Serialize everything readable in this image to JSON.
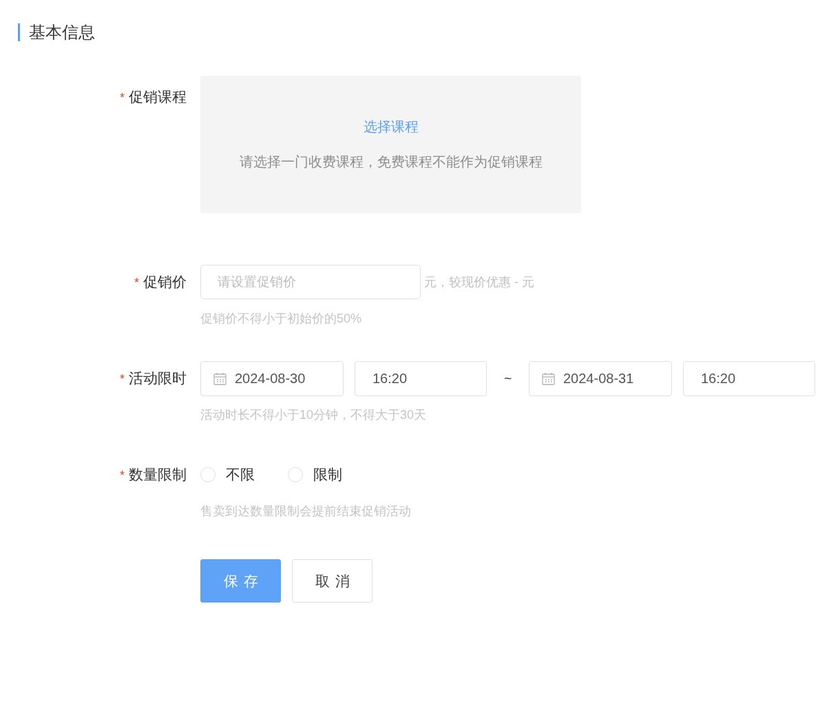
{
  "section": {
    "title": "基本信息"
  },
  "fields": [
    {
      "kind": "course",
      "label": "促销课程",
      "required_mark": "*",
      "link": "选择课程",
      "description": "请选择一门收费课程，免费课程不能作为促销课程"
    },
    {
      "kind": "price",
      "label": "促销价",
      "required_mark": "*",
      "placeholder": "请设置促销价",
      "suffix": "元，较现价优惠 - 元",
      "hint": "促销价不得小于初始价的50%"
    },
    {
      "kind": "period",
      "label": "活动限时",
      "required_mark": "*",
      "start_date": "2024-08-30",
      "start_time": "16:20",
      "separator": "~",
      "end_date": "2024-08-31",
      "end_time": "16:20",
      "hint": "活动时长不得小于10分钟，不得大于30天"
    },
    {
      "kind": "quantity",
      "label": "数量限制",
      "required_mark": "*",
      "options": [
        {
          "label": "不限",
          "selected": false
        },
        {
          "label": "限制",
          "selected": false
        }
      ],
      "hint": "售卖到达数量限制会提前结束促销活动"
    }
  ],
  "buttons": [
    {
      "kind": "primary",
      "label": "保存"
    },
    {
      "kind": "default",
      "label": "取消"
    }
  ]
}
